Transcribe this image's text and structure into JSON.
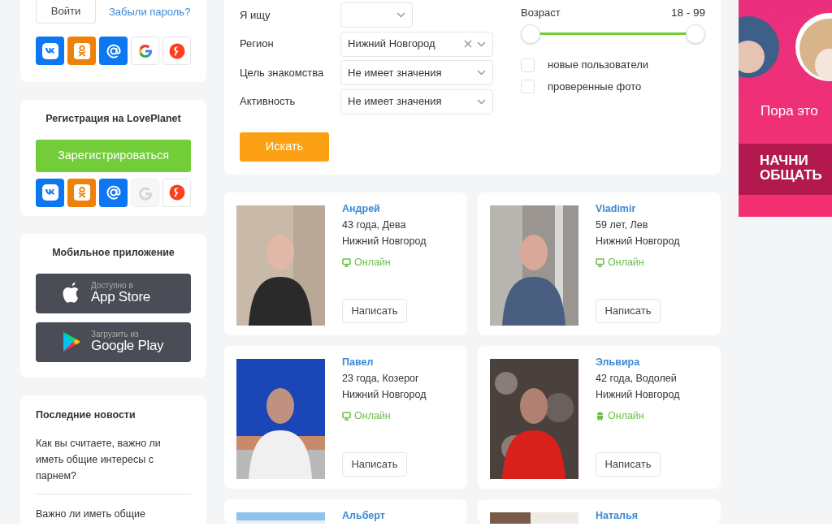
{
  "login": {
    "login_button": "Войти",
    "forgot_link": "Забыли пароль?",
    "socials": [
      {
        "kind": "vk",
        "muted": false
      },
      {
        "kind": "ok",
        "muted": false
      },
      {
        "kind": "mail",
        "muted": false
      },
      {
        "kind": "google",
        "muted": false
      },
      {
        "kind": "yandex",
        "muted": false
      }
    ]
  },
  "registration": {
    "title": "Регистрация на LovePlanet",
    "button": "Зарегистрироваться",
    "socials": [
      {
        "kind": "vk",
        "muted": false
      },
      {
        "kind": "ok",
        "muted": false
      },
      {
        "kind": "mail",
        "muted": false
      },
      {
        "kind": "google",
        "muted": true
      },
      {
        "kind": "yandex",
        "muted": false
      }
    ]
  },
  "mobile_app": {
    "title": "Мобильное приложение",
    "stores": [
      {
        "kind": "apple",
        "caption": "Доступно в",
        "name": "App Store"
      },
      {
        "kind": "google",
        "caption": "Загрузить из",
        "name": "Google Play"
      }
    ]
  },
  "news": {
    "title": "Последние новости",
    "items": [
      "Как вы считаете, важно ли иметь общие интересы с парнем?",
      "Важно ли иметь общие"
    ]
  },
  "search": {
    "fields": [
      {
        "label": "Я ищу",
        "clearable": false,
        "short": true
      },
      {
        "label": "Регион",
        "value": "Нижний Новгород",
        "clearable": true,
        "short": false
      },
      {
        "label": "Цель знакомства",
        "value": "Не имеет значения",
        "clearable": false,
        "short": false
      },
      {
        "label": "Активность",
        "value": "Не имеет значения",
        "clearable": false,
        "short": false
      }
    ],
    "submit": "Искать",
    "age_label": "Возраст",
    "age_reading": "18 - 99",
    "age_low": {
      "level": 0
    },
    "age_high": {
      "level": 1
    },
    "options": [
      {
        "label": "новые пользователи",
        "checked": false
      },
      {
        "label": "проверенные фото",
        "checked": false
      }
    ]
  },
  "profiles": [
    {
      "name": "Андрей",
      "details": "43 года, Дева",
      "city": "Нижний Новгород",
      "status": "Онлайн",
      "kind": "desktop",
      "button": "Написать"
    },
    {
      "name": "Vladimir",
      "details": "59 лет, Лев",
      "city": "Нижний Новгород",
      "status": "Онлайн",
      "kind": "desktop",
      "button": "Написать"
    },
    {
      "name": "Павел",
      "details": "23 года, Козерог",
      "city": "Нижний Новгород",
      "status": "Онлайн",
      "kind": "desktop",
      "button": "Написать"
    },
    {
      "name": "Эльвира",
      "details": "42 года, Водолей",
      "city": "Нижний Новгород",
      "status": "Онлайн",
      "kind": "mobile",
      "button": "Написать"
    },
    {
      "name": "Альберт"
    },
    {
      "name": "Наталья"
    }
  ],
  "ad": {
    "tagline": "Пора это",
    "cta_lines": [
      "НАЧНИ",
      "ОБЩАТЬ"
    ]
  }
}
